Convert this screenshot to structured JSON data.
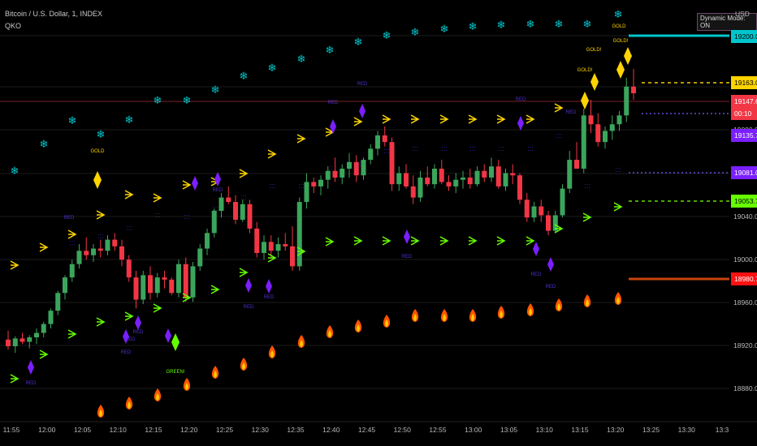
{
  "header": {
    "symbol": "Bitcoin / U.S. Dollar, 1, INDEX",
    "indicator": "QKO"
  },
  "dynamic_mode_label": "Dynamic Mode: ON",
  "currency": "USD",
  "price_scale": [
    "19200.00",
    "19120.00",
    "19080.00",
    "19040.00",
    "19000.00",
    "18960.00",
    "18920.00",
    "18880.00"
  ],
  "price_tags": [
    {
      "text": "19200.00",
      "color": "#00c6cc",
      "dark": true
    },
    {
      "text": "19163.01",
      "color": "#ffd400",
      "dark": true
    },
    {
      "text": "19147.63",
      "color": "#f23645",
      "dark": false
    },
    {
      "text": "00:10",
      "color": "#f23645",
      "dark": false
    },
    {
      "text": "19135.70",
      "color": "#7b1fff",
      "dark": false
    },
    {
      "text": "19081.09",
      "color": "#7b1fff",
      "dark": false
    },
    {
      "text": "19053.79",
      "color": "#66ff00",
      "dark": true
    },
    {
      "text": "18980.77",
      "color": "#ff1111",
      "dark": false
    }
  ],
  "time_axis": [
    "11:55",
    "12:00",
    "12:05",
    "12:10",
    "12:15",
    "12:20",
    "12:25",
    "12:30",
    "12:35",
    "12:40",
    "12:45",
    "12:50",
    "12:55",
    "13:00",
    "13:05",
    "13:10",
    "13:15",
    "13:20",
    "13:25",
    "13:30",
    "13:3"
  ],
  "annotations": {
    "gold": "GOLD",
    "golds": "GOLD!",
    "green": "GREEN!",
    "red": "RED"
  },
  "colors": {
    "bull": "#3ba55c",
    "bear": "#f23645",
    "cyan": "#00c6cc",
    "gold": "#ffd400",
    "purple": "#7b1fff",
    "lime": "#66ff00",
    "flame": "#ff6a00"
  },
  "chart_data": {
    "type": "candlestick",
    "ylim": [
      18850,
      19230
    ],
    "candles": [
      [
        18924,
        18932,
        18915,
        18918
      ],
      [
        18918,
        18927,
        18912,
        18925
      ],
      [
        18925,
        18930,
        18920,
        18922
      ],
      [
        18922,
        18928,
        18916,
        18926
      ],
      [
        18926,
        18934,
        18920,
        18930
      ],
      [
        18930,
        18940,
        18926,
        18938
      ],
      [
        18938,
        18952,
        18934,
        18950
      ],
      [
        18950,
        18968,
        18946,
        18966
      ],
      [
        18966,
        18982,
        18960,
        18980
      ],
      [
        18980,
        18996,
        18976,
        18992
      ],
      [
        18992,
        19010,
        18988,
        19004
      ],
      [
        19004,
        19016,
        18996,
        19000
      ],
      [
        19000,
        19010,
        18994,
        19006
      ],
      [
        19006,
        19014,
        18998,
        19004
      ],
      [
        19004,
        19018,
        19000,
        19014
      ],
      [
        19014,
        19020,
        19004,
        19008
      ],
      [
        19008,
        19014,
        18990,
        18996
      ],
      [
        18996,
        19000,
        18976,
        18980
      ],
      [
        18980,
        18986,
        18952,
        18960
      ],
      [
        18960,
        18986,
        18956,
        18982
      ],
      [
        18982,
        18990,
        18960,
        18966
      ],
      [
        18966,
        18984,
        18962,
        18980
      ],
      [
        18980,
        18986,
        18970,
        18978
      ],
      [
        18978,
        18980,
        18964,
        18966
      ],
      [
        18966,
        18996,
        18962,
        18992
      ],
      [
        18992,
        18998,
        18958,
        18962
      ],
      [
        18962,
        18994,
        18958,
        18990
      ],
      [
        18990,
        19010,
        18986,
        19006
      ],
      [
        19006,
        19024,
        19000,
        19020
      ],
      [
        19020,
        19042,
        19016,
        19040
      ],
      [
        19040,
        19056,
        19034,
        19052
      ],
      [
        19052,
        19062,
        19046,
        19048
      ],
      [
        19048,
        19054,
        19028,
        19032
      ],
      [
        19032,
        19050,
        19030,
        19046
      ],
      [
        19046,
        19050,
        19020,
        19024
      ],
      [
        19024,
        19030,
        18998,
        19002
      ],
      [
        19002,
        19018,
        18996,
        19012
      ],
      [
        19012,
        19018,
        18998,
        19004
      ],
      [
        19004,
        19016,
        18998,
        19010
      ],
      [
        19010,
        19020,
        19004,
        19008
      ],
      [
        19008,
        19026,
        18986,
        18990
      ],
      [
        18990,
        19052,
        18986,
        19048
      ],
      [
        19048,
        19074,
        19042,
        19066
      ],
      [
        19066,
        19070,
        19056,
        19062
      ],
      [
        19062,
        19072,
        19054,
        19068
      ],
      [
        19068,
        19080,
        19060,
        19076
      ],
      [
        19076,
        19088,
        19066,
        19070
      ],
      [
        19070,
        19082,
        19064,
        19078
      ],
      [
        19078,
        19092,
        19070,
        19084
      ],
      [
        19084,
        19090,
        19066,
        19072
      ],
      [
        19072,
        19088,
        19068,
        19086
      ],
      [
        19086,
        19100,
        19082,
        19096
      ],
      [
        19096,
        19112,
        19090,
        19108
      ],
      [
        19108,
        19116,
        19098,
        19102
      ],
      [
        19102,
        19106,
        19058,
        19064
      ],
      [
        19064,
        19080,
        19058,
        19074
      ],
      [
        19074,
        19082,
        19060,
        19062
      ],
      [
        19062,
        19072,
        19046,
        19052
      ],
      [
        19052,
        19076,
        19048,
        19070
      ],
      [
        19070,
        19080,
        19062,
        19064
      ],
      [
        19064,
        19082,
        19060,
        19078
      ],
      [
        19078,
        19086,
        19064,
        19066
      ],
      [
        19066,
        19072,
        19058,
        19062
      ],
      [
        19062,
        19074,
        19056,
        19068
      ],
      [
        19068,
        19076,
        19060,
        19070
      ],
      [
        19070,
        19078,
        19060,
        19064
      ],
      [
        19064,
        19080,
        19062,
        19076
      ],
      [
        19076,
        19082,
        19066,
        19070
      ],
      [
        19070,
        19088,
        19066,
        19080
      ],
      [
        19080,
        19086,
        19060,
        19062
      ],
      [
        19062,
        19078,
        19058,
        19074
      ],
      [
        19074,
        19082,
        19064,
        19072
      ],
      [
        19072,
        19074,
        19046,
        19050
      ],
      [
        19050,
        19056,
        19030,
        19034
      ],
      [
        19034,
        19048,
        19030,
        19044
      ],
      [
        19044,
        19050,
        19030,
        19036
      ],
      [
        19036,
        19040,
        19018,
        19022
      ],
      [
        19022,
        19040,
        19020,
        19036
      ],
      [
        19036,
        19064,
        19034,
        19060
      ],
      [
        19060,
        19094,
        19056,
        19086
      ],
      [
        19086,
        19102,
        19080,
        19078
      ],
      [
        19078,
        19132,
        19074,
        19126
      ],
      [
        19126,
        19140,
        19110,
        19118
      ],
      [
        19118,
        19128,
        19098,
        19102
      ],
      [
        19102,
        19116,
        19096,
        19112
      ],
      [
        19112,
        19126,
        19104,
        19118
      ],
      [
        19118,
        19130,
        19112,
        19126
      ],
      [
        19126,
        19160,
        19120,
        19152
      ],
      [
        19152,
        19168,
        19140,
        19146
      ]
    ]
  }
}
